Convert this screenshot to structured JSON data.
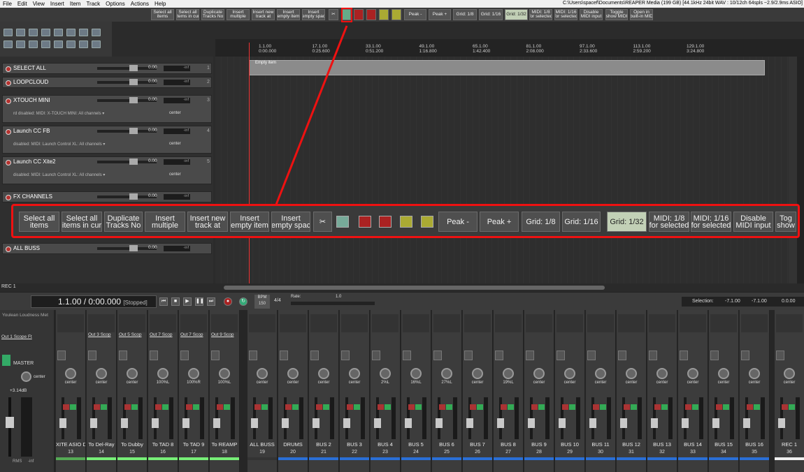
{
  "menu": [
    "File",
    "Edit",
    "View",
    "Insert",
    "Item",
    "Track",
    "Options",
    "Actions",
    "Help"
  ],
  "title_path": "C:\\Users\\spacef\\Documents\\REAPER Media (199 GB) [44.1kHz 24bit WAV : 10/12ch 64spls ~2.9/2.9ms ASIO]",
  "toolbar": {
    "buttons": [
      "Select all\nitems",
      "Select all\nitems in cur",
      "Duplicate\nTracks No",
      "Insert\nmultiple",
      "Insert new\ntrack at",
      "Insert\nempty item",
      "Insert\nempty spac"
    ],
    "peak_minus": "Peak -",
    "peak_plus": "Peak +",
    "grid_8": "Grid: 1/8",
    "grid_16": "Grid: 1/16",
    "grid_32": "Grid: 1/32",
    "midi_8": "MIDI: 1/8\nfor selected",
    "midi_16": "MIDI: 1/16\nfor selected",
    "disable_midi": "Disable\nMIDI input",
    "toggle_midi": "Toggle\nshow MIDI",
    "open_midi": "Open in\nbuilt-in MID"
  },
  "callout": {
    "buttons": [
      "Select all\nitems",
      "Select all\nitems in cur",
      "Duplicate\nTracks No",
      "Insert\nmultiple",
      "Insert new\ntrack at",
      "Insert\nempty item",
      "Insert\nempty spac"
    ],
    "peak_minus": "Peak -",
    "peak_plus": "Peak +",
    "grid_8": "Grid: 1/8",
    "grid_16": "Grid: 1/16",
    "grid_32": "Grid: 1/32",
    "midi_8": "MIDI: 1/8\nfor selected",
    "midi_16": "MIDI: 1/16\nfor selected",
    "disable_midi": "Disable\nMIDI input",
    "toggle": "Tog\nshow"
  },
  "ruler": [
    "1.1.00\n0:00.000",
    "17.1.00\n0:25.600",
    "33.1.00\n0:51.200",
    "49.1.00\n1:16.800",
    "65.1.00\n1:42.400",
    "81.1.00\n2:08.000",
    "97.1.00\n2:33.600",
    "113.1.00\n2:59.200",
    "129.1.00\n3:24.800"
  ],
  "empty_item": "Empty item",
  "tracks": [
    {
      "name": "SELECT ALL",
      "num": "1",
      "db": "0.00",
      "vu": "-inf"
    },
    {
      "name": "LOOPCLOUD",
      "num": "2",
      "db": "0.00",
      "vu": "-inf"
    },
    {
      "name": "XTOUCH MINI",
      "num": "3",
      "db": "0.00",
      "vu": "-inf",
      "sub": "rd disabled: MIDI: X-TOUCH MINI: All channels ▾",
      "pan": "center"
    },
    {
      "name": "Launch CC FB",
      "num": "4",
      "db": "0.00",
      "vu": "-inf",
      "sub": "disabled: MIDI: Launch Control XL: All channels ▾",
      "pan": "center"
    },
    {
      "name": "Launch CC Xite2",
      "num": "5",
      "db": "0.00",
      "vu": "-inf",
      "sub": "disabled: MIDI: Launch Control XL: All channels ▾",
      "pan": "center"
    },
    {
      "name": "FX CHANNELS",
      "num": "",
      "db": "0.00",
      "vu": "-inf"
    },
    {
      "name": "ALL BUSS",
      "num": "",
      "db": "0.00",
      "vu": "-inf"
    }
  ],
  "rec_label": "REC 1",
  "transport": {
    "time": "1.1.00 / 0:00.000",
    "state": "[Stopped]",
    "bpm_label": "BPM",
    "bpm": "150",
    "sig": "4/4",
    "rate_label": "Rate:",
    "rate": "1.0",
    "sel_label": "Selection:",
    "sel_start": "-7.1.00",
    "sel_end": "-7.1.00",
    "sel_len": "0.0.00"
  },
  "master": {
    "name": "MASTER",
    "plugin": "Youlean Loudness Met",
    "out": "Out 1 Scope Ft",
    "pan": "center",
    "db": "+3.14dB",
    "rms": "RMS",
    "inf": "-inf"
  },
  "strips": [
    {
      "name": "XITE ASIO D",
      "num": "13",
      "out": "",
      "pan": "center",
      "bar": "#5a5"
    },
    {
      "name": "To Del-Ray",
      "num": "14",
      "out": "Out 3 Scop",
      "pan": "center",
      "bar": "#7e7"
    },
    {
      "name": "To Dubby",
      "num": "15",
      "out": "Out 5 Scop",
      "pan": "center",
      "bar": "#7e7"
    },
    {
      "name": "To TAD 8",
      "num": "16",
      "out": "Out 7 Scop",
      "pan": "100%L",
      "bar": "#7e7"
    },
    {
      "name": "To TAD 9",
      "num": "17",
      "out": "Out 7 Scop",
      "pan": "100%R",
      "bar": "#7e7"
    },
    {
      "name": "To REAMP",
      "num": "18",
      "out": "Out 9 Scop",
      "pan": "100%L",
      "bar": "#7e7"
    },
    {
      "name": "ALL BUSS",
      "num": "19",
      "out": "",
      "pan": "center",
      "bar": "#333"
    },
    {
      "name": "DRUMS",
      "num": "20",
      "out": "",
      "pan": "center",
      "bar": "#2a6fd6"
    },
    {
      "name": "BUS 2",
      "num": "21",
      "out": "",
      "pan": "center",
      "bar": "#2a6fd6"
    },
    {
      "name": "BUS 3",
      "num": "22",
      "out": "",
      "pan": "center",
      "bar": "#2a6fd6"
    },
    {
      "name": "BUS 4",
      "num": "23",
      "out": "",
      "pan": "2%L",
      "bar": "#2a6fd6"
    },
    {
      "name": "BUS 5",
      "num": "24",
      "out": "",
      "pan": "16%L",
      "bar": "#2a6fd6"
    },
    {
      "name": "BUS 6",
      "num": "25",
      "out": "",
      "pan": "27%L",
      "bar": "#2a6fd6"
    },
    {
      "name": "BUS 7",
      "num": "26",
      "out": "",
      "pan": "center",
      "bar": "#2a6fd6"
    },
    {
      "name": "BUS 8",
      "num": "27",
      "out": "",
      "pan": "19%L",
      "bar": "#2a6fd6"
    },
    {
      "name": "BUS 9",
      "num": "28",
      "out": "",
      "pan": "center",
      "bar": "#2a6fd6"
    },
    {
      "name": "BUS 10",
      "num": "29",
      "out": "",
      "pan": "center",
      "bar": "#2a6fd6"
    },
    {
      "name": "BUS 11",
      "num": "30",
      "out": "",
      "pan": "center",
      "bar": "#2a6fd6"
    },
    {
      "name": "BUS 12",
      "num": "31",
      "out": "",
      "pan": "center",
      "bar": "#2a6fd6"
    },
    {
      "name": "BUS 13",
      "num": "32",
      "out": "",
      "pan": "center",
      "bar": "#2a6fd6"
    },
    {
      "name": "BUS 14",
      "num": "33",
      "out": "",
      "pan": "center",
      "bar": "#2a6fd6"
    },
    {
      "name": "BUS 15",
      "num": "34",
      "out": "",
      "pan": "center",
      "bar": "#2a6fd6"
    },
    {
      "name": "BUS 16",
      "num": "35",
      "out": "",
      "pan": "center",
      "bar": "#2a6fd6"
    },
    {
      "name": "REC 1",
      "num": "36",
      "out": "",
      "pan": "center",
      "bar": "#eee"
    }
  ],
  "colors": {
    "accent": "#e11",
    "rec": "#b5322f",
    "select": "#c2d0b6"
  }
}
